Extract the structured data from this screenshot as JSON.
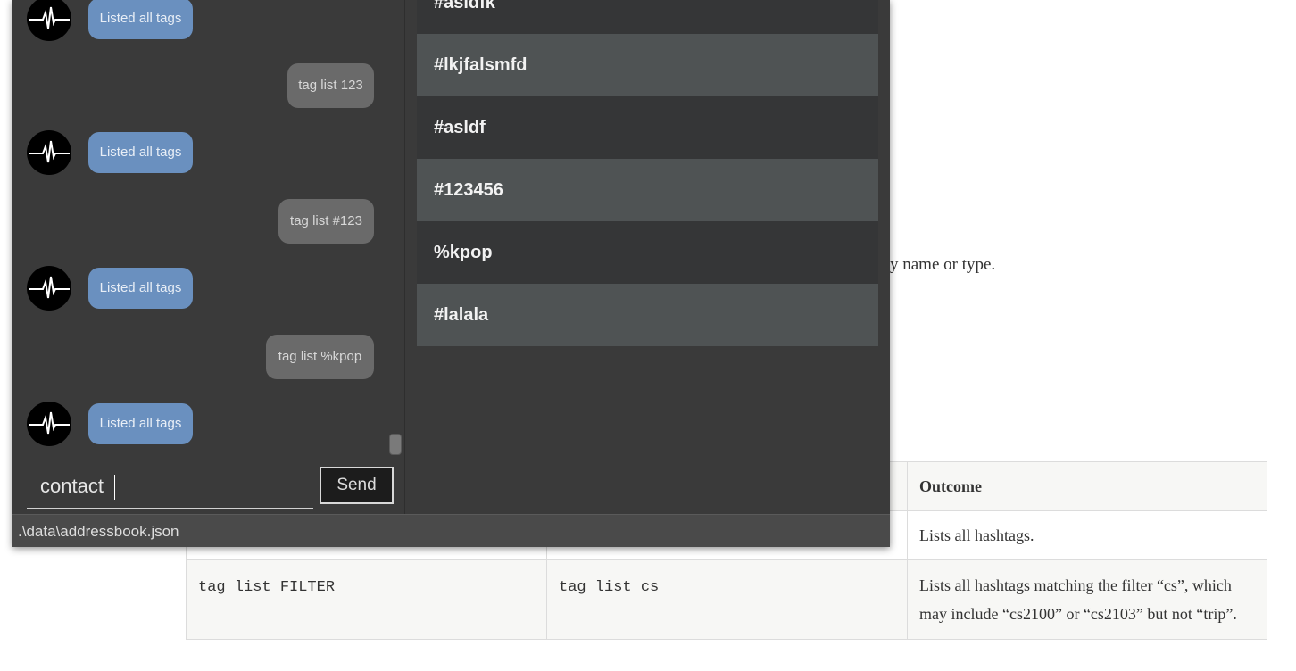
{
  "document": {
    "text_fragment": "y name or type.",
    "table": {
      "header_outcome": "Outcome",
      "row1_outcome": "Lists all hashtags.",
      "row2_format": "tag list FILTER",
      "row2_example": "tag list cs",
      "row2_outcome": "Lists all hashtags matching the filter “cs”, which may include “cs2100” or “cs2103” but not “trip”."
    }
  },
  "chat": {
    "messages": [
      {
        "from": "bot",
        "text": "Listed all tags"
      },
      {
        "from": "user",
        "text": "tag list 123"
      },
      {
        "from": "bot",
        "text": "Listed all tags"
      },
      {
        "from": "user",
        "text": "tag list #123"
      },
      {
        "from": "bot",
        "text": "Listed all tags"
      },
      {
        "from": "user",
        "text": "tag list %kpop"
      },
      {
        "from": "bot",
        "text": "Listed all tags"
      }
    ],
    "input_value": "contact",
    "send_label": "Send"
  },
  "tags": [
    "#asldfk",
    "#lkjfalsmfd",
    "#asldf",
    "#123456",
    "%kpop",
    "#lalala"
  ],
  "status_bar": {
    "path": ".\\data\\addressbook.json"
  },
  "colors": {
    "bot_bubble": "#6a90bf",
    "user_bubble": "#6a6a6a",
    "tag_row_light": "#4f5354",
    "tag_row_dark": "#353637"
  }
}
